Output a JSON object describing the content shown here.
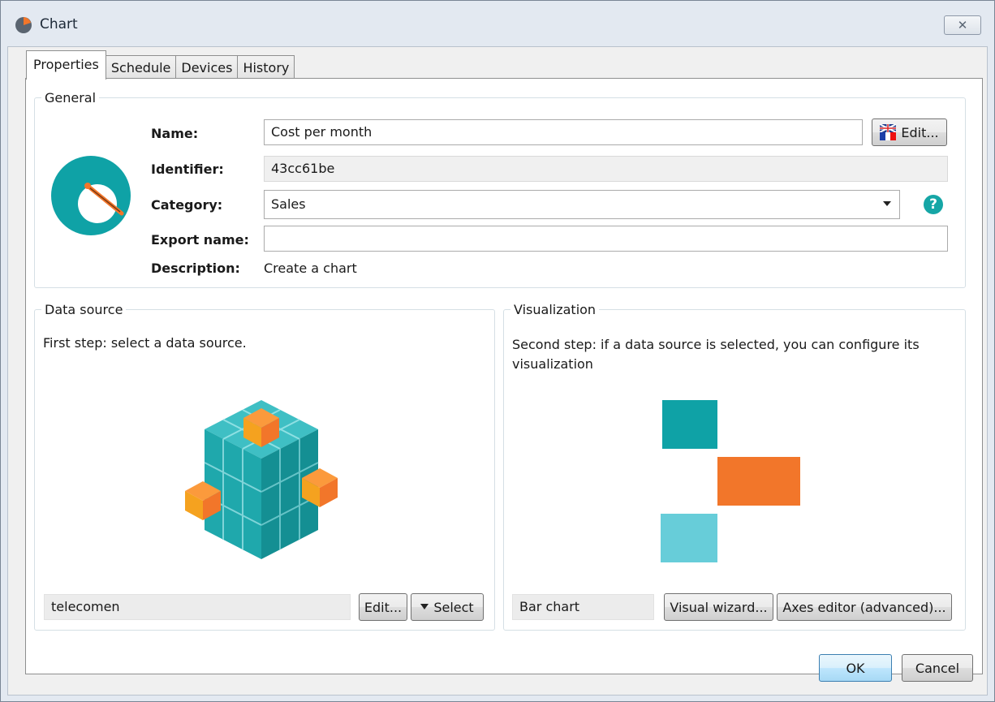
{
  "window": {
    "title": "Chart",
    "close_label": "✕"
  },
  "tabs": [
    {
      "label": "Properties",
      "active": true
    },
    {
      "label": "Schedule",
      "active": false
    },
    {
      "label": "Devices",
      "active": false
    },
    {
      "label": "History",
      "active": false
    }
  ],
  "general": {
    "legend": "General",
    "name_label": "Name:",
    "name_value": "Cost per month",
    "edit_button": "Edit...",
    "identifier_label": "Identifier:",
    "identifier_value": "43cc61be",
    "category_label": "Category:",
    "category_value": "Sales",
    "export_label": "Export name:",
    "export_value": "",
    "description_label": "Description:",
    "description_value": "Create a chart",
    "help_icon": "?"
  },
  "datasource": {
    "legend": "Data source",
    "instruction": "First step: select a data source.",
    "value": "telecomen",
    "edit_button": "Edit...",
    "select_button": "Select"
  },
  "visualization": {
    "legend": "Visualization",
    "instruction": "Second step: if a data source is selected, you can configure its visualization",
    "value": "Bar chart",
    "wizard_button": "Visual wizard...",
    "axes_button": "Axes editor (advanced)..."
  },
  "footer": {
    "ok_button": "OK",
    "cancel_button": "Cancel"
  },
  "colors": {
    "teal": "#0fa2a6",
    "orange": "#f2762a",
    "light_teal": "#67cdd9",
    "accent_blue": "#3c7fb1"
  },
  "icons": {
    "app": "chart-app-icon",
    "flag": "uk-france-flag-icon",
    "help": "question-circle-icon",
    "cube": "data-cube-icon",
    "bars": "bar-visualization-icon",
    "dropdown": "chevron-down-icon"
  }
}
